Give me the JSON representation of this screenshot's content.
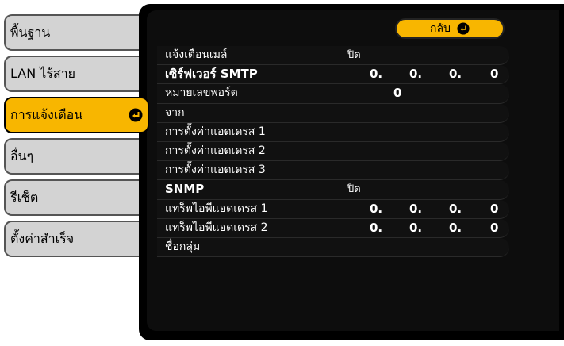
{
  "tabs": [
    {
      "label": "พื้นฐาน"
    },
    {
      "label": "LAN ไร้สาย"
    },
    {
      "label": "การแจ้งเตือน"
    },
    {
      "label": "อื่นๆ"
    },
    {
      "label": "รีเซ็ต"
    },
    {
      "label": "ตั้งค่าสำเร็จ"
    }
  ],
  "back_button": {
    "label": "กลับ"
  },
  "rows": {
    "mail_notify": {
      "label": "แจ้งเตือนเมล์",
      "value": "ปิด"
    },
    "smtp_server": {
      "label": "เซิร์ฟเวอร์ SMTP",
      "octets": [
        "0.",
        "0.",
        "0.",
        "0"
      ]
    },
    "port": {
      "label": "หมายเลขพอร์ต",
      "value": "0"
    },
    "from": {
      "label": "จาก"
    },
    "addr1": {
      "label": "การตั้งค่าแอดเดรส 1"
    },
    "addr2": {
      "label": "การตั้งค่าแอดเดรส 2"
    },
    "addr3": {
      "label": "การตั้งค่าแอดเดรส 3"
    },
    "snmp": {
      "label": "SNMP",
      "value": "ปิด"
    },
    "trap1": {
      "label": "แทร็พไอพีแอดเดรส 1",
      "octets": [
        "0.",
        "0.",
        "0.",
        "0"
      ]
    },
    "trap2": {
      "label": "แทร็พไอพีแอดเดรส 2",
      "octets": [
        "0.",
        "0.",
        "0.",
        "0"
      ]
    },
    "community": {
      "label": "ชื่อกลุ่ม"
    }
  }
}
